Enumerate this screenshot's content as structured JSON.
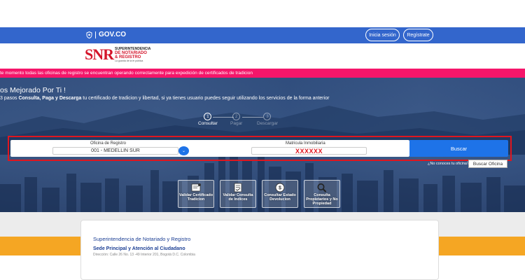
{
  "govbar": {
    "logo_text": "GOV.CO",
    "login_label": "Inicia sesión",
    "register_label": "Regístrate",
    "color": "#3366cc"
  },
  "brand": {
    "mark": "SNR",
    "line1": "SUPERINTENDENCIA",
    "line2": "DE NOTARIADO",
    "line3": "& REGISTRO",
    "line4": "La guarda de la fe pública"
  },
  "alert": {
    "text": "te momento todas las oficinas de registro se encuentran operando correctamente para expedición de certificados de tradicion",
    "color": "#f5166a"
  },
  "hero": {
    "title": "os Mejorado Por Ti !",
    "sub_pre": "3 pasos ",
    "sub_bold": "Consulta, Paga y Descarga",
    "sub_post": " tu certificado de tradicion y libertad, si ya tienes usuario puedes seguir utilizando los servicios de la forma anterior"
  },
  "steps": [
    {
      "number": "1",
      "label": "Consultar",
      "active": true
    },
    {
      "number": "2",
      "label": "Pagar",
      "active": false
    },
    {
      "number": "3",
      "label": "Descargar",
      "active": false
    }
  ],
  "search": {
    "oficina_label": "Oficina de Registro",
    "oficina_value": "001 - MEDELLIN SUR",
    "matricula_label": "Matricula Inmobiliaria",
    "matricula_value": "XXXXXX",
    "buscar_label": "Buscar",
    "oficina_question": "¿No conoces tu oficina?",
    "buscar_oficina_label": "Buscar Oficina",
    "highlight_color": "#e0161f",
    "button_color": "#1e73e8"
  },
  "tiles": [
    {
      "label": "Validar Certificado Tradicion",
      "icon": "certificate-icon"
    },
    {
      "label": "Validar Consulta de Indices",
      "icon": "document-check-icon"
    },
    {
      "label": "Consultar Estado Devolucion",
      "icon": "money-icon"
    },
    {
      "label": "Consulta Propietarios y No Propiedad",
      "icon": "magnifier-icon"
    }
  ],
  "footer": {
    "card_title": "Superintendencia de Notariado y Registro",
    "card_sub": "Sede Principal y Atención al Ciudadano",
    "card_addr": "Dirección: Calle 26 No. 13 -49 Interior 201, Bogotá D.C. Colombia",
    "strip_color": "#f5a623"
  }
}
